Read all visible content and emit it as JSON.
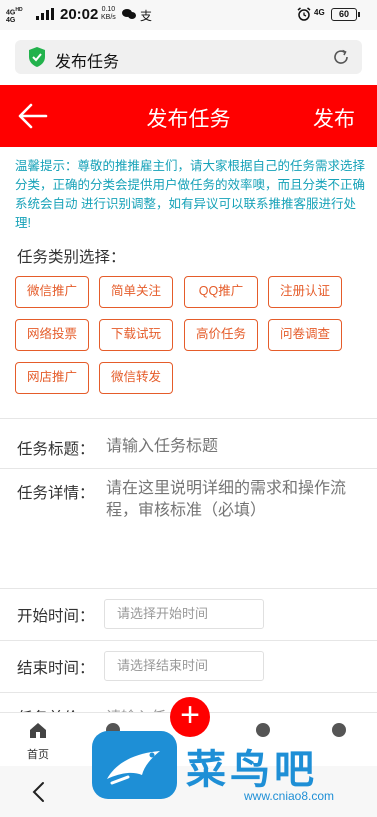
{
  "status_bar": {
    "network_left": "4G HD\n4G",
    "time": "20:02",
    "speed": "0.10\nKB/s",
    "alipay": "支",
    "network_right": "4G",
    "battery": "60"
  },
  "browser": {
    "page_title": "发布任务"
  },
  "header": {
    "title": "发布任务",
    "publish_label": "发布"
  },
  "tip": "温馨提示：尊敬的推推雇主们，请大家根据自己的任务需求选择分类，正确的分类会提供用户做任务的效率噢，而且分类不正确系统会自动 进行识别调整，如有异议可以联系推推客服进行处理!",
  "category": {
    "label": "任务类别选择：",
    "items": [
      "微信推广",
      "简单关注",
      "QQ推广",
      "注册认证",
      "网络投票",
      "下载试玩",
      "高价任务",
      "问卷调查",
      "网店推广",
      "微信转发"
    ]
  },
  "form": {
    "title_label": "任务标题：",
    "title_placeholder": "请输入任务标题",
    "detail_label": "任务详情：",
    "detail_placeholder": "请在这里说明详细的需求和操作流程，审核标准（必填）",
    "start_label": "开始时间：",
    "start_placeholder": "请选择开始时间",
    "end_label": "结束时间：",
    "end_placeholder": "请选择结束时间",
    "price_label": "任务单价",
    "price_placeholder": "请输入任"
  },
  "bottom_nav": {
    "home_label": "首页",
    "fab_label": "+"
  },
  "watermark": {
    "text": "菜鸟吧",
    "url": "www.cniao8.com"
  },
  "colors": {
    "header_red": "#ff0000",
    "tip_teal": "#17a2b8",
    "category_orange": "#e55c2a",
    "watermark_blue": "#1e8fd6"
  }
}
